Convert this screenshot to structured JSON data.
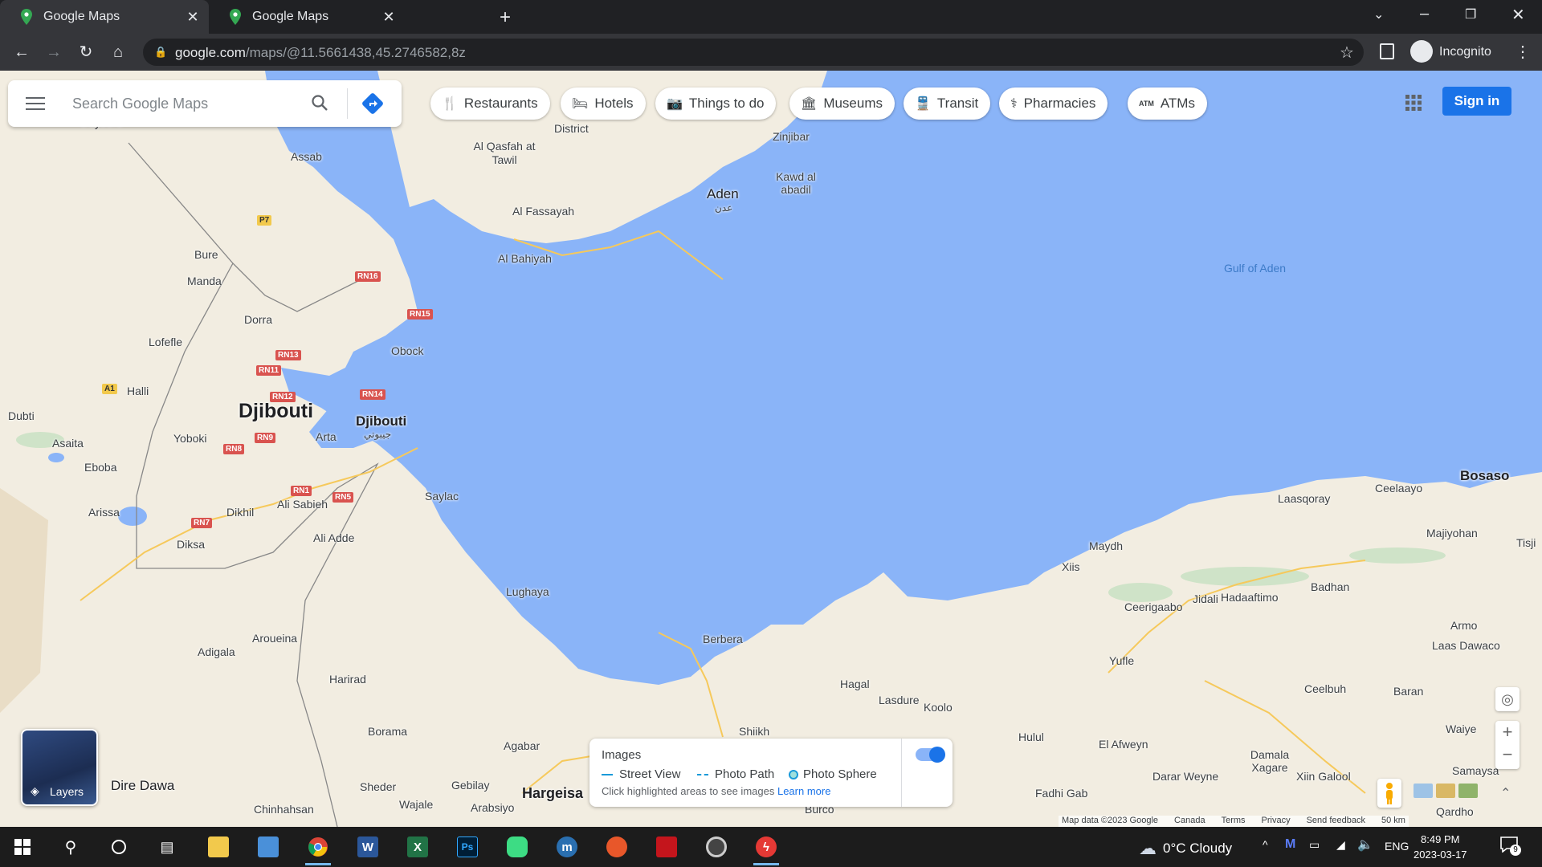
{
  "browser": {
    "tabs": [
      {
        "title": "Google Maps"
      },
      {
        "title": "Google Maps"
      }
    ],
    "url_host": "google.com",
    "url_path": "/maps/@11.5661438,45.2746582,8z",
    "profile_label": "Incognito"
  },
  "search": {
    "placeholder": "Search Google Maps"
  },
  "chips": [
    {
      "label": "Restaurants",
      "icon": "fork-knife-icon"
    },
    {
      "label": "Hotels",
      "icon": "bed-icon"
    },
    {
      "label": "Things to do",
      "icon": "camera-icon"
    },
    {
      "label": "Museums",
      "icon": "museum-icon"
    },
    {
      "label": "Transit",
      "icon": "train-icon"
    },
    {
      "label": "Pharmacies",
      "icon": "pharmacy-icon"
    },
    {
      "label": "ATMs",
      "icon": "atm-icon"
    }
  ],
  "signin_label": "Sign in",
  "map": {
    "places": {
      "dayburu": "Dayburu",
      "assab": "Assab",
      "bure": "Bure",
      "manda": "Manda",
      "dorra": "Dorra",
      "lofefle": "Lofefle",
      "halli": "Halli",
      "obock": "Obock",
      "djibouti_country": "Djibouti",
      "djibouti_city": "Djibouti",
      "djibouti_arabic": "جيبوتي",
      "arta": "Arta",
      "dubti": "Dubti",
      "asaita": "Asaita",
      "yoboki": "Yoboki",
      "eboba": "Eboba",
      "arissa": "Arissa",
      "dikhil": "Dikhil",
      "ali_sabieh": "Ali Sabieh",
      "ali_adde": "Ali Adde",
      "diksa": "Diksa",
      "saylac": "Saylac",
      "lughaya": "Lughaya",
      "adigala": "Adigala",
      "aroueina": "Aroueina",
      "harirad": "Harirad",
      "borama": "Borama",
      "agabar": "Agabar",
      "dire_dawa": "Dire Dawa",
      "sheder": "Sheder",
      "gebilay": "Gebilay",
      "hargeisa": "Hargeisa",
      "arabsiyo": "Arabsiyo",
      "chinhahsan": "Chinhahsan",
      "wajale": "Wajale",
      "aden": "Aden",
      "aden_arabic": "عدن",
      "zinjibar": "Zinjibar",
      "kawd_al_abadil": "Kawd al abadil",
      "al_qasfah": "Al Qasfah at Tawil",
      "district": "District",
      "al_fassayah": "Al Fassayah",
      "al_bahiyah": "Al Bahiyah",
      "gulf": "Gulf of Aden",
      "berbera": "Berbera",
      "hagal": "Hagal",
      "lasdure": "Lasdure",
      "koolo": "Koolo",
      "shiikh": "Shiikh",
      "hulul": "Hulul",
      "el_afweyn": "El Afweyn",
      "fadhi_gab": "Fadhi Gab",
      "darar_weyne": "Darar Weyne",
      "damala_xagare": "Damala Xagare",
      "xiin_galool": "Xiin Galool",
      "maydh": "Maydh",
      "xiis": "Xiis",
      "ceerigaabo": "Ceerigaabo",
      "jidali": "Jidali",
      "hadaaftimo": "Hadaaftimo",
      "yufle": "Yufle",
      "badhan": "Badhan",
      "laasqoray": "Laasqoray",
      "ceelaayo": "Ceelaayo",
      "bosaso": "Bosaso",
      "majiyohan": "Majiyohan",
      "armo": "Armo",
      "laas_dawaco": "Laas Dawaco",
      "ceelbuh": "Ceelbuh",
      "baran": "Baran",
      "waiye": "Waiye",
      "samaysa": "Samaysa",
      "tisji": "Tisji",
      "burco": "Burco",
      "qardho": "Qardho"
    },
    "roads": [
      "P7",
      "RN16",
      "RN15",
      "RN13",
      "RN11",
      "A1",
      "RN12",
      "RN14",
      "RN9",
      "RN8",
      "RN1",
      "RN5",
      "RN7"
    ]
  },
  "layers_label": "Layers",
  "images_panel": {
    "title": "Images",
    "street_view": "Street View",
    "photo_path": "Photo Path",
    "photo_sphere": "Photo Sphere",
    "hint": "Click highlighted areas to see images",
    "learn_more": "Learn more",
    "toggle_on": true
  },
  "attribution": {
    "map_data": "Map data ©2023 Google",
    "region": "Canada",
    "terms": "Terms",
    "privacy": "Privacy",
    "feedback": "Send feedback",
    "scale": "50 km"
  },
  "taskbar": {
    "weather": "0°C  Cloudy",
    "lang": "ENG",
    "time": "8:49 PM",
    "date": "2023-03-17",
    "notifications": "9"
  },
  "colors": {
    "water": "#8ab4f8",
    "land": "#f2ede1",
    "accent": "#1a73e8"
  }
}
